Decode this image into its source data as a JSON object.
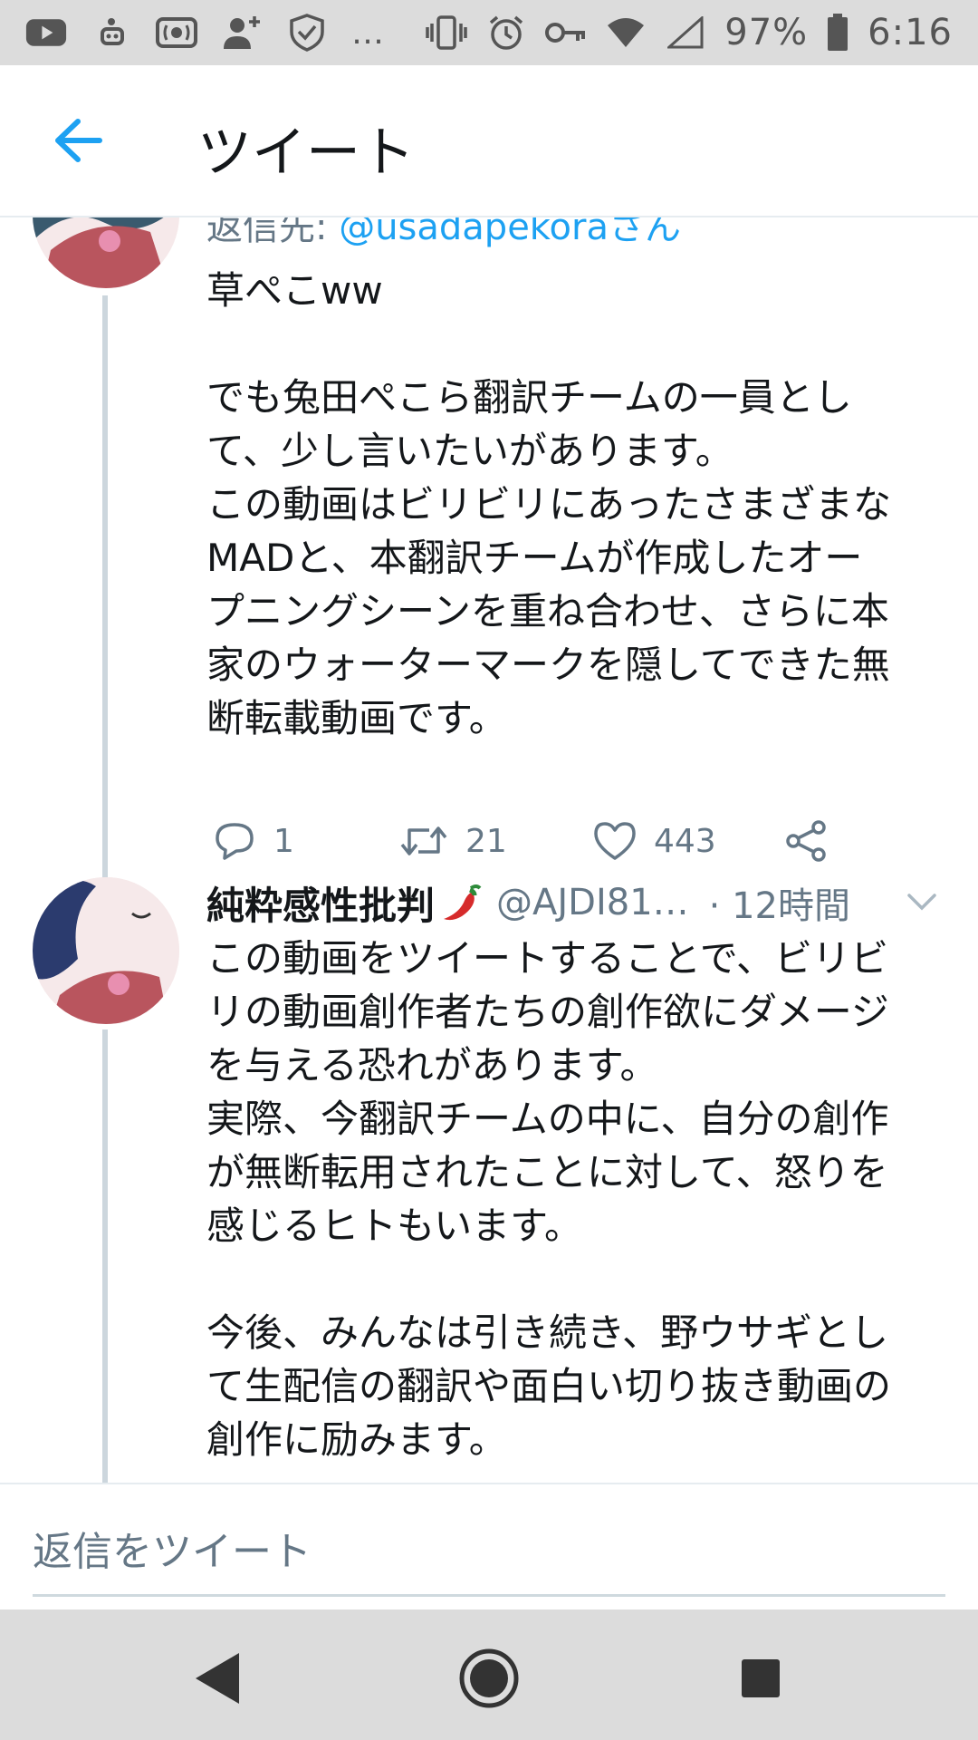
{
  "status_bar": {
    "battery_percent": "97%",
    "time": "6:16",
    "overflow": "…",
    "icons": [
      "youtube-icon",
      "app-icon",
      "radio-icon",
      "add-person-icon",
      "shield-icon",
      "vibrate-icon",
      "alarm-icon",
      "key-icon",
      "wifi-icon",
      "signal-icon",
      "battery-icon"
    ]
  },
  "header": {
    "title": "ツイート",
    "back_icon": "arrow-left-icon"
  },
  "tweet1": {
    "reply_prefix": "返信先: ",
    "reply_handle": "@usadapekoraさん",
    "text": "草ぺこww\n\nでも兔田ぺこら翻訳チームの一員とし\nて、少し言いたいがあります。\nこの動画はビリビリにあったさまざまな\nMADと、本翻訳チームが作成したオー\nプニングシーンを重ね合わせ、さらに本\n家のウォーターマークを隠してできた無\n断転載動画です。",
    "reply_count": "1",
    "retweet_count": "21",
    "like_count": "443"
  },
  "tweet2": {
    "name": "純粋感性批判",
    "handle": "@AJDI81…",
    "time": "· 12時間",
    "text": "この動画をツイートすることで、ビリビ\nリの動画創作者たちの創作欲にダメージ\nを与える恐れがあります。\n実際、今翻訳チームの中に、自分の創作\nが無断転用されたことに対して、怒りを\n感じるヒトもいます。\n\n今後、みんなは引き続き、野ウサギとし\nて生配信の翻訳や面白い切り抜き動画の\n創作に励みます。"
  },
  "composer": {
    "placeholder": "返信をツイート"
  },
  "colors": {
    "accent": "#1da1f2",
    "secondary_text": "#657786",
    "thread_line": "#ccd6dd",
    "system_bar": "#dcdcdc"
  }
}
